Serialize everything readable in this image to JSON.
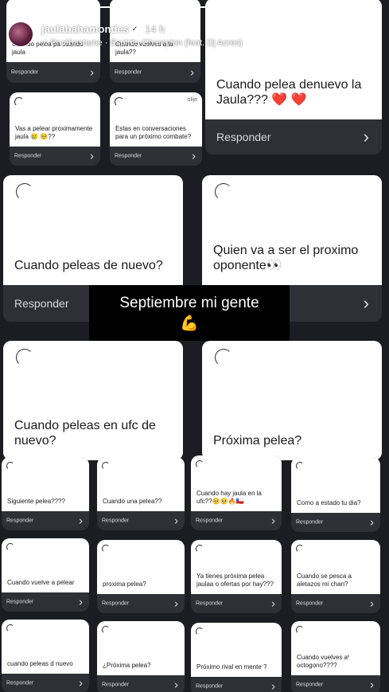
{
  "header": {
    "username": "jaulabahamondes",
    "time": "14 h",
    "music": "Pruébastame · Espíritu Champion (feat. Dj Acres)",
    "progress": 0.98,
    "verified_glyph": "✓"
  },
  "icons": {
    "mute": "speaker-muted-icon",
    "pause": "pause-icon",
    "more": "more-icon",
    "send": "send-icon",
    "chevron": "chevron-right-icon"
  },
  "sticker": {
    "text": "Septiembre mi gente",
    "emoji": "💪"
  },
  "reply_label": "Responder",
  "cards": [
    {
      "q": "Cuando pelea pa cuando jaula"
    },
    {
      "q": "Cuando vuelves a la jaula??"
    },
    {
      "q": "Cuando pelea denuevo la Jaula??? ❤️ ❤️"
    },
    {
      "q": "Vas a pelear proximamente jaula 😢 🥺??"
    },
    {
      "q": "Estas en conversaciones para un próximo combate?",
      "tag": "olije"
    },
    {
      "q": "Cuando peleas de nuevo?"
    },
    {
      "q": "Quien va a ser el proximo oponente👀"
    },
    {
      "q": "Cuando peleas en ufc de nuevo?"
    },
    {
      "q": "Próxima pelea?"
    },
    {
      "q": "Siguiente pelea????"
    },
    {
      "q": "Cuando una pelea??"
    },
    {
      "q": "Cuando hay jaula en la ufc??🥺🥺🔥🇨🇱"
    },
    {
      "q": "Como a estado tu dia?"
    },
    {
      "q": "Cuando vuelve a pelear"
    },
    {
      "q": "proxima pelea?"
    },
    {
      "q": "Ya tienes próxima pelea jaulaa o ofertas por hay???"
    },
    {
      "q": "Cuando se pesca a aletazos mi chan?"
    },
    {
      "q": "cuando peleas d nuevo"
    },
    {
      "q": "¿Próxima pelea?"
    },
    {
      "q": "Próximo rival en mente ?"
    },
    {
      "q": "Cuando vuelves al octogono????"
    }
  ]
}
